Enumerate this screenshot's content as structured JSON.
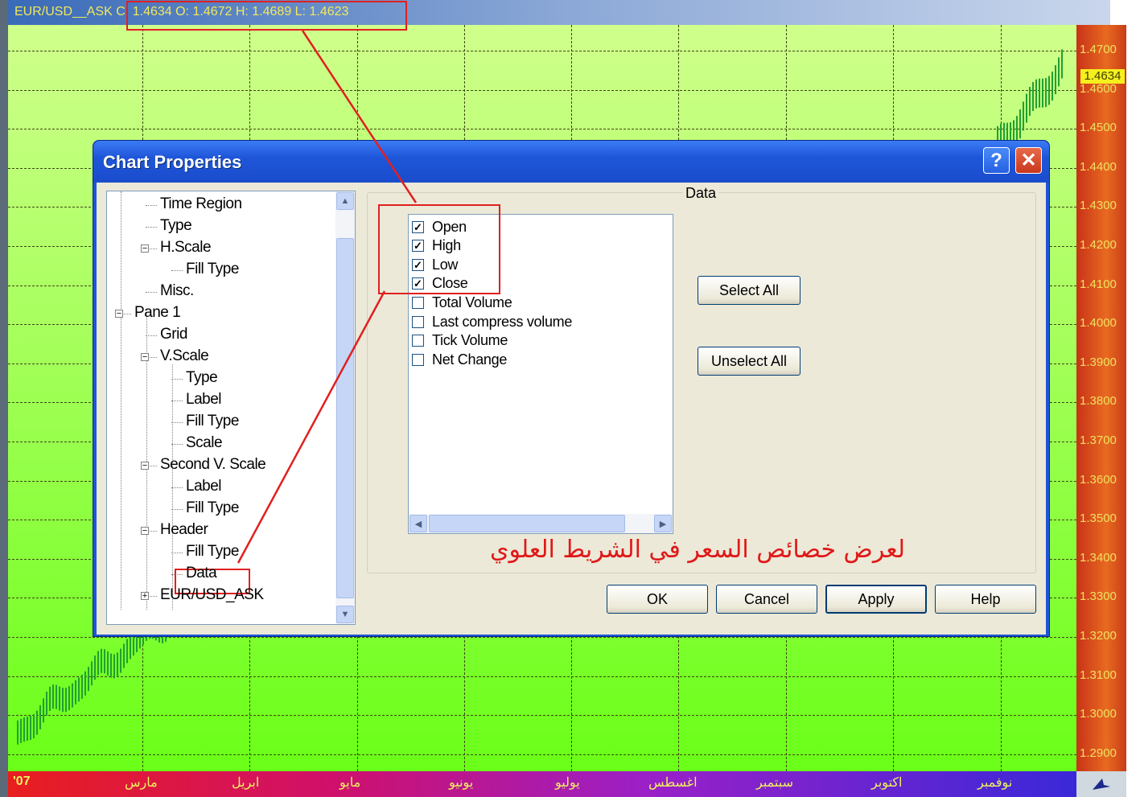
{
  "chart": {
    "header_symbol": "EUR/USD__ASK",
    "header_values": "C: 1.4634 O: 1.4672 H: 1.4689 L: 1.4623",
    "last_price": "1.4634",
    "price_ticks": [
      "1.4700",
      "1.4600",
      "1.4500",
      "1.4400",
      "1.4300",
      "1.4200",
      "1.4100",
      "1.4000",
      "1.3900",
      "1.3800",
      "1.3700",
      "1.3600",
      "1.3500",
      "1.3400",
      "1.3300",
      "1.3200",
      "1.3100",
      "1.3000",
      "1.2900"
    ],
    "year_label": "'07",
    "months": [
      "مارس",
      "ابريل",
      "مايو",
      "يونيو",
      "يوليو",
      "اغسطس",
      "سبتمبر",
      "اكتوبر",
      "نوفمبر"
    ]
  },
  "dialog": {
    "title": "Chart Properties",
    "help_glyph": "?",
    "close_glyph": "✕",
    "tree": [
      {
        "label": "Time Region"
      },
      {
        "label": "Type"
      },
      {
        "label": "H.Scale"
      },
      {
        "label": "Fill Type"
      },
      {
        "label": "Misc."
      },
      {
        "label": "Pane 1"
      },
      {
        "label": "Grid"
      },
      {
        "label": "V.Scale"
      },
      {
        "label": "Type"
      },
      {
        "label": "Label"
      },
      {
        "label": "Fill Type"
      },
      {
        "label": "Scale"
      },
      {
        "label": "Second V. Scale"
      },
      {
        "label": "Label"
      },
      {
        "label": "Fill Type"
      },
      {
        "label": "Header"
      },
      {
        "label": "Fill Type"
      },
      {
        "label": "Data"
      },
      {
        "label": "EUR/USD_ASK"
      }
    ],
    "group_label": "Data",
    "data_items": [
      {
        "label": "Open",
        "checked": true
      },
      {
        "label": "High",
        "checked": true
      },
      {
        "label": "Low",
        "checked": true
      },
      {
        "label": "Close",
        "checked": true
      },
      {
        "label": "Total Volume",
        "checked": false
      },
      {
        "label": "Last compress volume",
        "checked": false
      },
      {
        "label": "Tick Volume",
        "checked": false
      },
      {
        "label": "Net Change",
        "checked": false
      }
    ],
    "select_all_label": "Select All",
    "unselect_all_label": "Unselect All",
    "ok_label": "OK",
    "cancel_label": "Cancel",
    "apply_label": "Apply",
    "help_label": "Help",
    "annotation": "لعرض خصائص السعر في الشريط العلوي"
  },
  "colors": {
    "annotation_red": "#e02020"
  }
}
